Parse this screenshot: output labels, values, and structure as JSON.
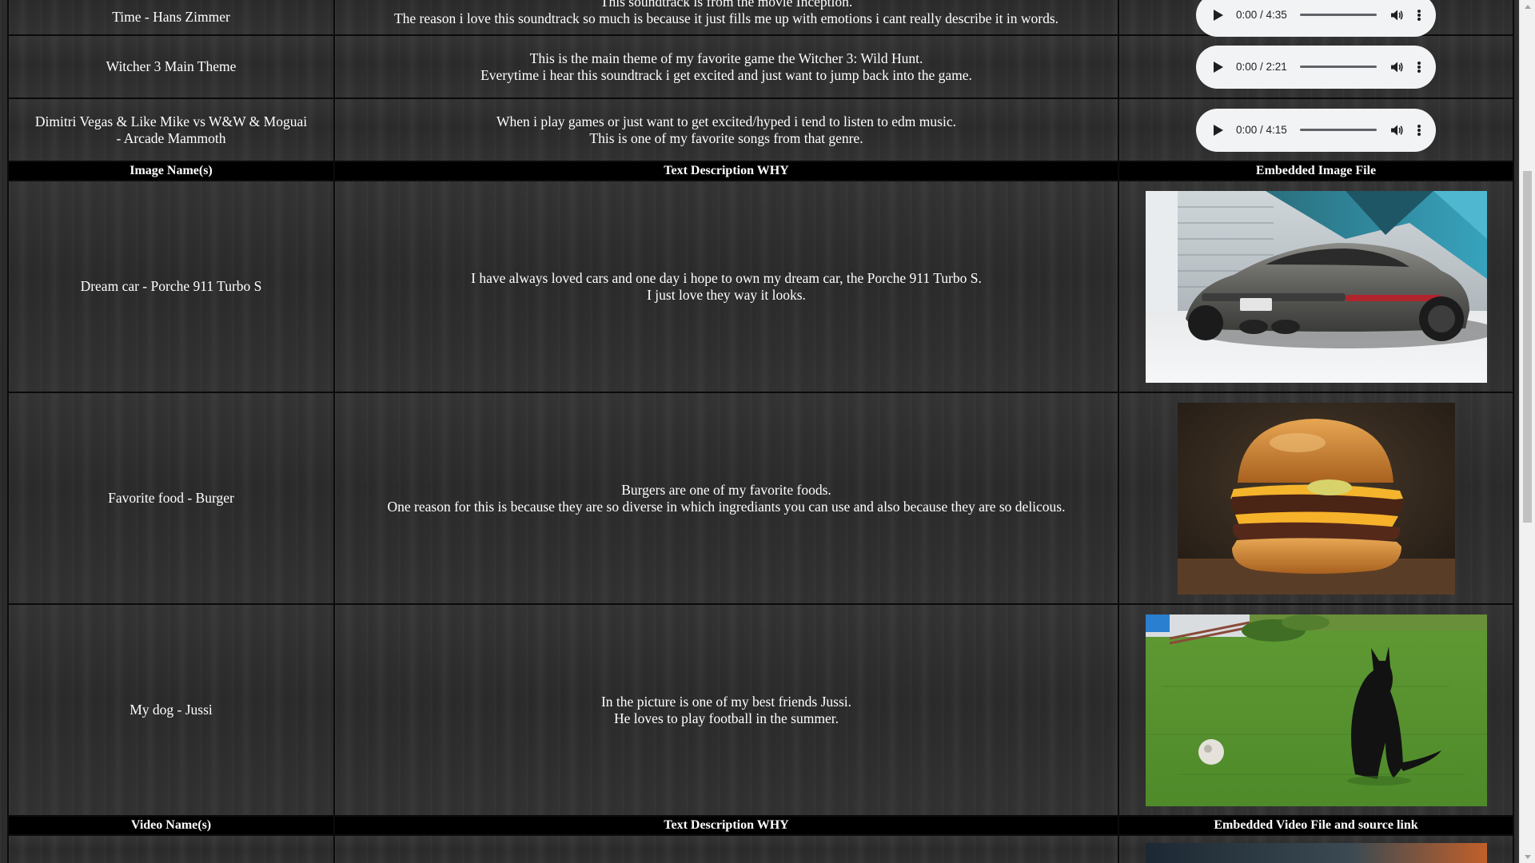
{
  "audio_rows": [
    {
      "name": "Time - Hans Zimmer",
      "desc_lines": [
        "This soundtrack is from the movie Inception.",
        "The reason i love this soundtrack so much is because it just fills me up with emotions i cant really describe it in words."
      ],
      "player": {
        "time": "0:00 / 4:35",
        "progress": 0.0
      }
    },
    {
      "name": "Witcher 3 Main Theme",
      "desc_lines": [
        "This is the main theme of my favorite game the Witcher 3: Wild Hunt.",
        "Everytime i hear this soundtrack i get excited and just want to jump back into the game."
      ],
      "player": {
        "time": "0:00 / 2:21",
        "progress": 0.0
      }
    },
    {
      "name_lines": [
        "Dimitri Vegas & Like Mike vs W&W & Moguai",
        "- Arcade Mammoth"
      ],
      "desc_lines": [
        "When i play games or just want to get excited/hyped i tend to listen to edm music.",
        "This is one of my favorite songs from that genre."
      ],
      "player": {
        "time": "0:00 / 4:15",
        "progress": 0.0
      }
    }
  ],
  "image_header": {
    "name": "Image Name(s)",
    "desc": "Text Description WHY",
    "media": "Embedded Image File"
  },
  "image_rows": [
    {
      "name": "Dream car - Porche 911 Turbo S",
      "desc_lines": [
        "I have always loved cars and one day i hope to own my dream car, the Porche 911 Turbo S.",
        "I just love they way it looks."
      ],
      "image": "porsche-photo"
    },
    {
      "name": "Favorite food - Burger",
      "desc_lines": [
        "Burgers are one of my favorite foods.",
        "One reason for this is because they are so diverse in which ingrediants you can use and also because they are so delicous."
      ],
      "image": "burger-photo"
    },
    {
      "name": "My dog - Jussi",
      "desc_lines": [
        "In the picture is one of my best friends Jussi.",
        "He loves to play football in the summer."
      ],
      "image": "dog-photo"
    }
  ],
  "video_header": {
    "name": "Video Name(s)",
    "desc": "Text Description WHY",
    "media": "Embedded Video File and source link"
  },
  "colors": {
    "header_bg": "#000000",
    "player_bg": "#f1f3f4",
    "text": "#ffffff"
  }
}
